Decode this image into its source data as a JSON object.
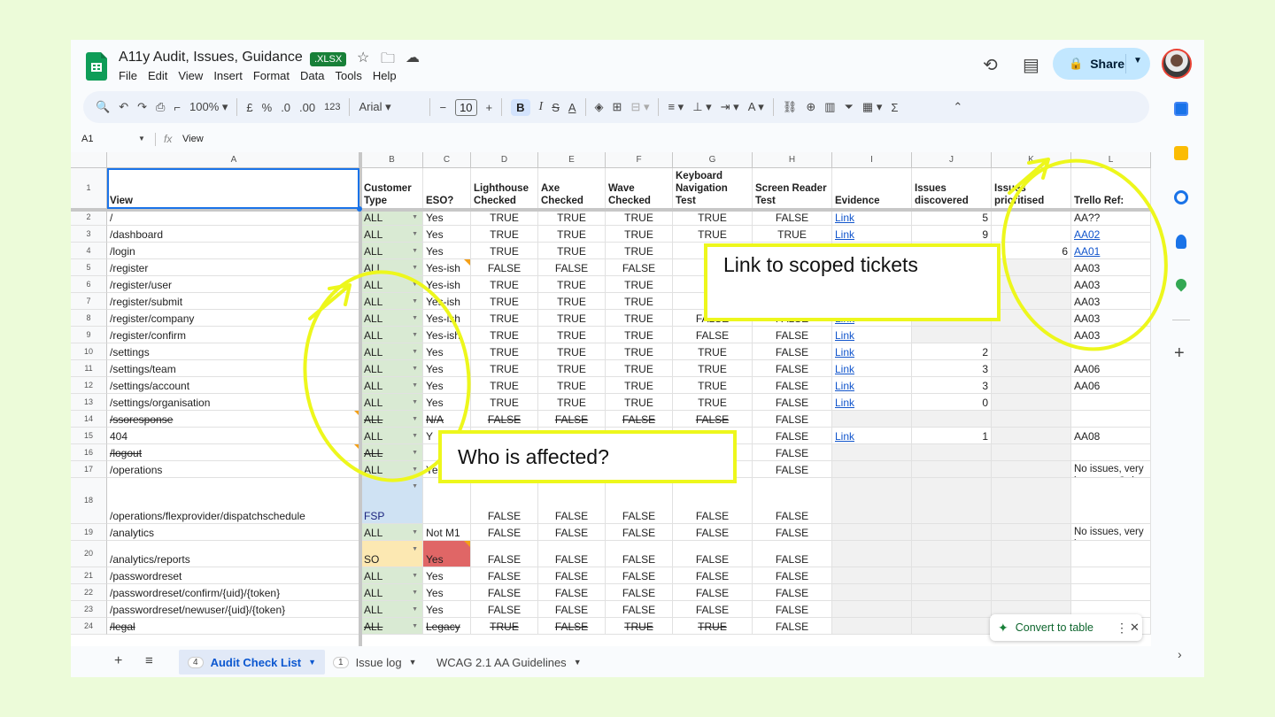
{
  "title_bar": {
    "doc_title": "A11y Audit, Issues, Guidance",
    "file_badge": ".XLSX",
    "menu": [
      "File",
      "Edit",
      "View",
      "Insert",
      "Format",
      "Data",
      "Tools",
      "Help"
    ],
    "share_label": "Share"
  },
  "toolbar": {
    "zoom": "100%",
    "currency": "£",
    "percent": "%",
    "dec_decrease": ".0",
    "dec_increase": ".00",
    "number_format": "123",
    "font": "Arial",
    "font_size": "10",
    "bold": "B",
    "italic": "I"
  },
  "formula_bar": {
    "cell_ref": "A1",
    "content": "View"
  },
  "columns": [
    "A",
    "B",
    "C",
    "D",
    "E",
    "F",
    "G",
    "H",
    "I",
    "J",
    "K",
    "L"
  ],
  "header_row": {
    "num": "1",
    "cells": [
      "View",
      "Customer Type",
      "ESO?",
      "Lighthouse Checked",
      "Axe Checked",
      "Wave Checked",
      "Keyboard Navigation Test",
      "Screen Reader Test",
      "Evidence",
      "Issues discovered",
      "Issues prioritised",
      "Trello Ref:"
    ]
  },
  "rows": [
    {
      "num": "2",
      "view": "/",
      "type": "ALL",
      "eso": "Yes",
      "lh": "TRUE",
      "axe": "TRUE",
      "wave": "TRUE",
      "kb": "TRUE",
      "sr": "FALSE",
      "evidence": "Link",
      "issues": "5",
      "prio": "",
      "trello": "AA??"
    },
    {
      "num": "3",
      "view": "/dashboard",
      "type": "ALL",
      "eso": "Yes",
      "lh": "TRUE",
      "axe": "TRUE",
      "wave": "TRUE",
      "kb": "TRUE",
      "sr": "TRUE",
      "evidence": "Link",
      "issues": "9",
      "prio": "",
      "trello": "AA02"
    },
    {
      "num": "4",
      "view": "/login",
      "type": "ALL",
      "eso": "Yes",
      "lh": "TRUE",
      "axe": "TRUE",
      "wave": "TRUE",
      "kb": "T",
      "sr": "",
      "evidence": "",
      "issues": "",
      "prio": "6",
      "trello": "AA01"
    },
    {
      "num": "5",
      "view": "/register",
      "type": "ALL",
      "eso": "Yes-ish",
      "lh": "FALSE",
      "axe": "FALSE",
      "wave": "FALSE",
      "kb": "F",
      "sr": "",
      "evidence": "",
      "issues": "",
      "prio": "",
      "trello": "AA03"
    },
    {
      "num": "6",
      "view": "/register/user",
      "type": "ALL",
      "eso": "Yes-ish",
      "lh": "TRUE",
      "axe": "TRUE",
      "wave": "TRUE",
      "kb": "F",
      "sr": "",
      "evidence": "",
      "issues": "",
      "prio": "",
      "trello": "AA03"
    },
    {
      "num": "7",
      "view": "/register/submit",
      "type": "ALL",
      "eso": "Yes-ish",
      "lh": "TRUE",
      "axe": "TRUE",
      "wave": "TRUE",
      "kb": "F",
      "sr": "",
      "evidence": "",
      "issues": "",
      "prio": "",
      "trello": "AA03"
    },
    {
      "num": "8",
      "view": "/register/company",
      "type": "ALL",
      "eso": "Yes-ish",
      "lh": "TRUE",
      "axe": "TRUE",
      "wave": "TRUE",
      "kb": "FALSE",
      "sr": "FALSE",
      "evidence": "Link",
      "issues": "",
      "prio": "",
      "trello": "AA03"
    },
    {
      "num": "9",
      "view": "/register/confirm",
      "type": "ALL",
      "eso": "Yes-ish",
      "lh": "TRUE",
      "axe": "TRUE",
      "wave": "TRUE",
      "kb": "FALSE",
      "sr": "FALSE",
      "evidence": "Link",
      "issues": "",
      "prio": "",
      "trello": "AA03"
    },
    {
      "num": "10",
      "view": "/settings",
      "type": "ALL",
      "eso": "Yes",
      "lh": "TRUE",
      "axe": "TRUE",
      "wave": "TRUE",
      "kb": "TRUE",
      "sr": "FALSE",
      "evidence": "Link",
      "issues": "2",
      "prio": "",
      "trello": ""
    },
    {
      "num": "11",
      "view": "/settings/team",
      "type": "ALL",
      "eso": "Yes",
      "lh": "TRUE",
      "axe": "TRUE",
      "wave": "TRUE",
      "kb": "TRUE",
      "sr": "FALSE",
      "evidence": "Link",
      "issues": "3",
      "prio": "",
      "trello": "AA06"
    },
    {
      "num": "12",
      "view": "/settings/account",
      "type": "ALL",
      "eso": "Yes",
      "lh": "TRUE",
      "axe": "TRUE",
      "wave": "TRUE",
      "kb": "TRUE",
      "sr": "FALSE",
      "evidence": "Link",
      "issues": "3",
      "prio": "",
      "trello": "AA06"
    },
    {
      "num": "13",
      "view": "/settings/organisation",
      "type": "ALL",
      "eso": "Yes",
      "lh": "TRUE",
      "axe": "TRUE",
      "wave": "TRUE",
      "kb": "TRUE",
      "sr": "FALSE",
      "evidence": "Link",
      "issues": "0",
      "prio": "",
      "trello": ""
    },
    {
      "num": "14",
      "view": "/ssoresponse",
      "type": "ALL",
      "eso": "N/A",
      "lh": "FALSE",
      "axe": "FALSE",
      "wave": "FALSE",
      "kb": "FALSE",
      "sr": "FALSE",
      "evidence": "",
      "issues": "",
      "prio": "",
      "trello": ""
    },
    {
      "num": "15",
      "view": "404",
      "type": "ALL",
      "eso": "Y",
      "lh": "",
      "axe": "",
      "wave": "",
      "kb": "",
      "sr": "FALSE",
      "evidence": "Link",
      "issues": "1",
      "prio": "",
      "trello": "AA08"
    },
    {
      "num": "16",
      "view": "/logout",
      "type": "ALL",
      "eso": "",
      "lh": "",
      "axe": "",
      "wave": "",
      "kb": "",
      "sr": "FALSE",
      "evidence": "",
      "issues": "",
      "prio": "",
      "trello": ""
    },
    {
      "num": "17",
      "view": "/operations",
      "type": "ALL",
      "eso": "Yes",
      "lh": "TRUE",
      "axe": "TRUE",
      "wave": "TRUE",
      "kb": "TRUE",
      "sr": "FALSE",
      "evidence": "",
      "issues": "",
      "prio": "",
      "trello": "No issues, very l content. Only the flagged as missi discernible links"
    },
    {
      "num": "18",
      "view": "/operations/flexprovider/dispatchschedule",
      "type": "FSP",
      "eso": "",
      "lh": "FALSE",
      "axe": "FALSE",
      "wave": "FALSE",
      "kb": "FALSE",
      "sr": "FALSE",
      "evidence": "",
      "issues": "",
      "prio": "",
      "trello": ""
    },
    {
      "num": "19",
      "view": "/analytics",
      "type": "ALL",
      "eso": "Not M1",
      "lh": "FALSE",
      "axe": "FALSE",
      "wave": "FALSE",
      "kb": "FALSE",
      "sr": "FALSE",
      "evidence": "",
      "issues": "",
      "prio": "",
      "trello": "No issues, very l content"
    },
    {
      "num": "20",
      "view": "/analytics/reports",
      "type": "SO",
      "eso": "Yes",
      "lh": "FALSE",
      "axe": "FALSE",
      "wave": "FALSE",
      "kb": "FALSE",
      "sr": "FALSE",
      "evidence": "",
      "issues": "",
      "prio": "",
      "trello": ""
    },
    {
      "num": "21",
      "view": "/passwordreset",
      "type": "ALL",
      "eso": "Yes",
      "lh": "FALSE",
      "axe": "FALSE",
      "wave": "FALSE",
      "kb": "FALSE",
      "sr": "FALSE",
      "evidence": "",
      "issues": "",
      "prio": "",
      "trello": ""
    },
    {
      "num": "22",
      "view": "/passwordreset/confirm/{uid}/{token}",
      "type": "ALL",
      "eso": "Yes",
      "lh": "FALSE",
      "axe": "FALSE",
      "wave": "FALSE",
      "kb": "FALSE",
      "sr": "FALSE",
      "evidence": "",
      "issues": "",
      "prio": "",
      "trello": ""
    },
    {
      "num": "23",
      "view": "/passwordreset/newuser/{uid}/{token}",
      "type": "ALL",
      "eso": "Yes",
      "lh": "FALSE",
      "axe": "FALSE",
      "wave": "FALSE",
      "kb": "FALSE",
      "sr": "FALSE",
      "evidence": "",
      "issues": "",
      "prio": "",
      "trello": ""
    },
    {
      "num": "24",
      "view": "/legal",
      "type": "ALL",
      "eso": "Legacy",
      "lh": "TRUE",
      "axe": "FALSE",
      "wave": "TRUE",
      "kb": "TRUE",
      "sr": "FALSE",
      "evidence": "",
      "issues": "",
      "prio": "",
      "trello": ""
    }
  ],
  "sheet_tabs": [
    {
      "badge": "4",
      "label": "Audit Check List",
      "active": true
    },
    {
      "badge": "1",
      "label": "Issue log",
      "active": false
    },
    {
      "badge": "",
      "label": "WCAG 2.1 AA Guidelines",
      "active": false
    }
  ],
  "convert_chip": {
    "label": "Convert to table"
  },
  "annotations": {
    "who_affected": "Who is affected?",
    "link_tickets": "Link to scoped tickets"
  },
  "colors": {
    "background": "#ecfbd9",
    "highlight": "#edf71c",
    "green_cell": "#d9ead3",
    "blue_cell": "#cfe2f3",
    "yellow_cell": "#fce8b2",
    "red_cell": "#e06666",
    "share_bg": "#c2e7ff"
  }
}
